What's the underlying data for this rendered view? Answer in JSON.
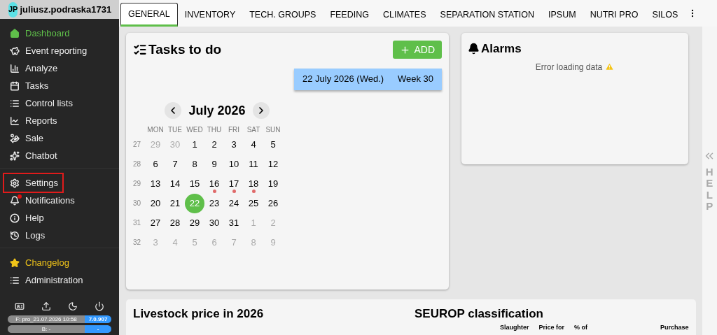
{
  "user": {
    "initials": "JP",
    "name": "juliusz.podraska1731"
  },
  "sidebar": {
    "groups": [
      [
        {
          "label": "Dashboard",
          "selected": true,
          "outlined": false,
          "badge": false
        },
        {
          "label": "Event reporting",
          "selected": false,
          "kind": "normal",
          "outlined": false,
          "badge": false
        },
        {
          "label": "Analyze",
          "selected": false,
          "kind": "normal",
          "outlined": false,
          "badge": false
        },
        {
          "label": "Tasks",
          "selected": false,
          "kind": "normal",
          "outlined": false,
          "badge": false
        },
        {
          "label": "Control lists",
          "selected": false,
          "kind": "normal",
          "outlined": false,
          "badge": false
        },
        {
          "label": "Reports",
          "selected": false,
          "kind": "normal",
          "outlined": false,
          "badge": false
        },
        {
          "label": "Sale",
          "selected": false,
          "kind": "normal",
          "outlined": false,
          "badge": false
        },
        {
          "label": "Chatbot",
          "selected": false,
          "kind": "normal",
          "outlined": false,
          "badge": false
        }
      ],
      [
        {
          "label": "Settings",
          "selected": false,
          "kind": "normal",
          "outlined": true,
          "badge": false
        },
        {
          "label": "Notifications",
          "selected": false,
          "kind": "normal",
          "outlined": false,
          "badge": true
        },
        {
          "label": "Help",
          "selected": false,
          "kind": "normal",
          "outlined": false,
          "badge": false
        },
        {
          "label": "Logs",
          "selected": false,
          "kind": "normal",
          "outlined": false,
          "badge": false
        }
      ],
      [
        {
          "label": "Changelog",
          "selected": false,
          "kind": "highlight",
          "outlined": false,
          "badge": false
        },
        {
          "label": "Administration",
          "selected": false,
          "kind": "normal",
          "outlined": false,
          "badge": false
        }
      ]
    ],
    "versions": [
      {
        "label": "F: pro_21.07.2026 10:58",
        "value": "7.0.907"
      },
      {
        "label": "B: -",
        "value": "-"
      }
    ]
  },
  "tabs": [
    {
      "label": "GENERAL",
      "selected": true
    },
    {
      "label": "INVENTORY",
      "selected": false
    },
    {
      "label": "TECH. GROUPS",
      "selected": false
    },
    {
      "label": "FEEDING",
      "selected": false
    },
    {
      "label": "CLIMATES",
      "selected": false
    },
    {
      "label": "SEPARATION STATION",
      "selected": false
    },
    {
      "label": "IPSUM",
      "selected": false
    },
    {
      "label": "NUTRI PRO",
      "selected": false
    },
    {
      "label": "SILOS",
      "selected": false
    }
  ],
  "tasks": {
    "title": "Tasks to do",
    "add_button": "ADD",
    "date": "22 July 2026 (Wed.)",
    "week": "Week 30",
    "calendar": {
      "month": "July 2026",
      "weekdays": [
        "MON",
        "TUE",
        "WED",
        "THU",
        "FRI",
        "SAT",
        "SUN"
      ],
      "weeks": [
        {
          "number": "27",
          "days": [
            {
              "day": "29",
              "muted": true,
              "event": false,
              "selected": false
            },
            {
              "day": "30",
              "muted": true,
              "event": false,
              "selected": false
            },
            {
              "day": "1",
              "muted": false,
              "event": false,
              "selected": false
            },
            {
              "day": "2",
              "muted": false,
              "event": false,
              "selected": false
            },
            {
              "day": "3",
              "muted": false,
              "event": false,
              "selected": false
            },
            {
              "day": "4",
              "muted": false,
              "event": false,
              "selected": false
            },
            {
              "day": "5",
              "muted": false,
              "event": false,
              "selected": false
            }
          ]
        },
        {
          "number": "28",
          "days": [
            {
              "day": "6",
              "muted": false,
              "event": false,
              "selected": false
            },
            {
              "day": "7",
              "muted": false,
              "event": false,
              "selected": false
            },
            {
              "day": "8",
              "muted": false,
              "event": false,
              "selected": false
            },
            {
              "day": "9",
              "muted": false,
              "event": false,
              "selected": false
            },
            {
              "day": "10",
              "muted": false,
              "event": false,
              "selected": false
            },
            {
              "day": "11",
              "muted": false,
              "event": false,
              "selected": false
            },
            {
              "day": "12",
              "muted": false,
              "event": false,
              "selected": false
            }
          ]
        },
        {
          "number": "29",
          "days": [
            {
              "day": "13",
              "muted": false,
              "event": false,
              "selected": false
            },
            {
              "day": "14",
              "muted": false,
              "event": false,
              "selected": false
            },
            {
              "day": "15",
              "muted": false,
              "event": false,
              "selected": false
            },
            {
              "day": "16",
              "muted": false,
              "event": true,
              "selected": false
            },
            {
              "day": "17",
              "muted": false,
              "event": true,
              "selected": false
            },
            {
              "day": "18",
              "muted": false,
              "event": true,
              "selected": false
            },
            {
              "day": "19",
              "muted": false,
              "event": false,
              "selected": false
            }
          ]
        },
        {
          "number": "30",
          "days": [
            {
              "day": "20",
              "muted": false,
              "event": false,
              "selected": false
            },
            {
              "day": "21",
              "muted": false,
              "event": false,
              "selected": false
            },
            {
              "day": "22",
              "event": false,
              "selected": true
            },
            {
              "day": "23",
              "muted": false,
              "event": false,
              "selected": false
            },
            {
              "day": "24",
              "muted": false,
              "event": false,
              "selected": false
            },
            {
              "day": "25",
              "muted": false,
              "event": false,
              "selected": false
            },
            {
              "day": "26",
              "muted": false,
              "event": false,
              "selected": false
            }
          ]
        },
        {
          "number": "31",
          "days": [
            {
              "day": "27",
              "muted": false,
              "event": false,
              "selected": false
            },
            {
              "day": "28",
              "muted": false,
              "event": false,
              "selected": false
            },
            {
              "day": "29",
              "muted": false,
              "event": false,
              "selected": false
            },
            {
              "day": "30",
              "muted": false,
              "event": false,
              "selected": false
            },
            {
              "day": "31",
              "muted": false,
              "event": false,
              "selected": false
            },
            {
              "day": "1",
              "muted": true,
              "event": false,
              "selected": false
            },
            {
              "day": "2",
              "muted": true,
              "event": false,
              "selected": false
            }
          ]
        },
        {
          "number": "32",
          "days": [
            {
              "day": "3",
              "muted": true,
              "event": false,
              "selected": false
            },
            {
              "day": "4",
              "muted": true,
              "event": false,
              "selected": false
            },
            {
              "day": "5",
              "muted": true,
              "event": false,
              "selected": false
            },
            {
              "day": "6",
              "muted": true,
              "event": false,
              "selected": false
            },
            {
              "day": "7",
              "muted": true,
              "event": false,
              "selected": false
            },
            {
              "day": "8",
              "muted": true,
              "event": false,
              "selected": false
            },
            {
              "day": "9",
              "muted": true,
              "event": false,
              "selected": false
            }
          ]
        }
      ]
    }
  },
  "alarms": {
    "title": "Alarms",
    "message": "Error loading data"
  },
  "help_panel": {
    "label": "HELP"
  },
  "livestock": {
    "title": "Livestock price in 2026"
  },
  "seurop": {
    "title": "SEUROP classification",
    "columns": [
      "Slaughter",
      "Price for",
      "% of",
      "Purchase"
    ]
  }
}
